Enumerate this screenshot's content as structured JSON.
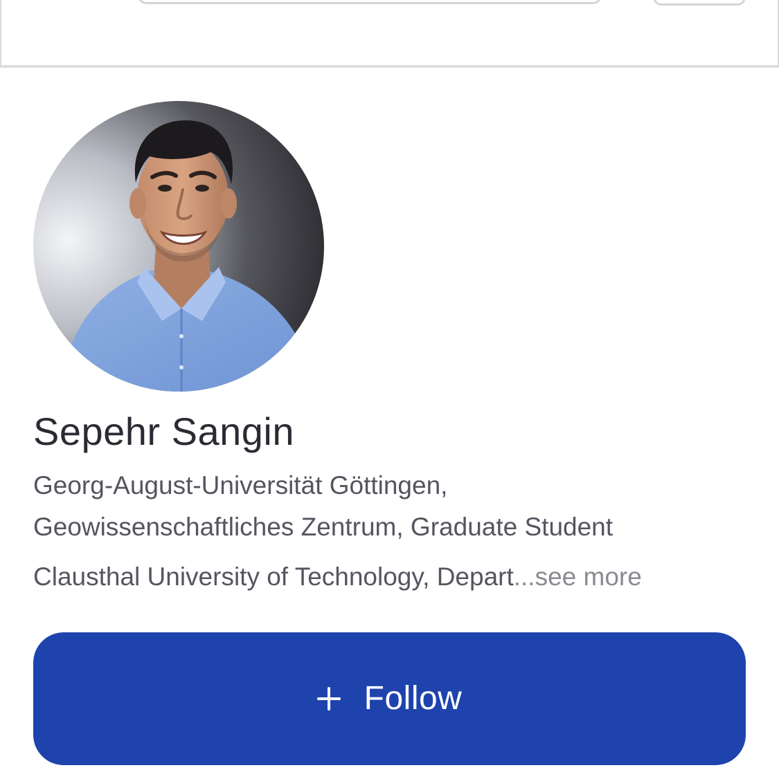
{
  "profile": {
    "name": "Sepehr Sangin",
    "affiliation_line1": "Georg-August-Universität Göttingen,",
    "affiliation_line2": "Geowissenschaftliches Zentrum, Graduate Student",
    "affiliation_line3": "Clausthal University of Technology, Depart",
    "ellipsis": "...",
    "see_more": "see more",
    "avatar_icon": "profile-photo"
  },
  "follow_button": {
    "label": "Follow",
    "icon": "plus-icon",
    "background": "#1e43ad",
    "text_color": "#ffffff"
  }
}
